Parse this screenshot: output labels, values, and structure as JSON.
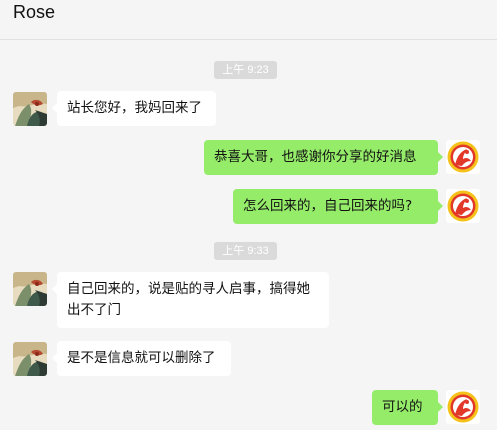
{
  "window": {
    "title": "Rose"
  },
  "messages": [
    {
      "kind": "time",
      "text": "上午 9:23"
    },
    {
      "kind": "msg",
      "side": "left",
      "text": "站长您好，我妈回来了"
    },
    {
      "kind": "msg",
      "side": "right",
      "text": "恭喜大哥，也感谢你分享的好消息"
    },
    {
      "kind": "msg",
      "side": "right",
      "text": "怎么回来的，自己回来的吗?"
    },
    {
      "kind": "time",
      "text": "上午 9:33"
    },
    {
      "kind": "msg",
      "side": "left",
      "lines": [
        "自己回来的，说是贴的寻人启事，搞得她",
        "出不了门"
      ]
    },
    {
      "kind": "msg",
      "side": "left",
      "text": "是不是信息就可以删除了"
    },
    {
      "kind": "msg",
      "side": "right",
      "text": "可以的"
    }
  ],
  "colors": {
    "chat_background": "#f5f5f5",
    "self_bubble": "#95ec69",
    "other_bubble": "#ffffff",
    "timestamp_background": "#dadada"
  }
}
